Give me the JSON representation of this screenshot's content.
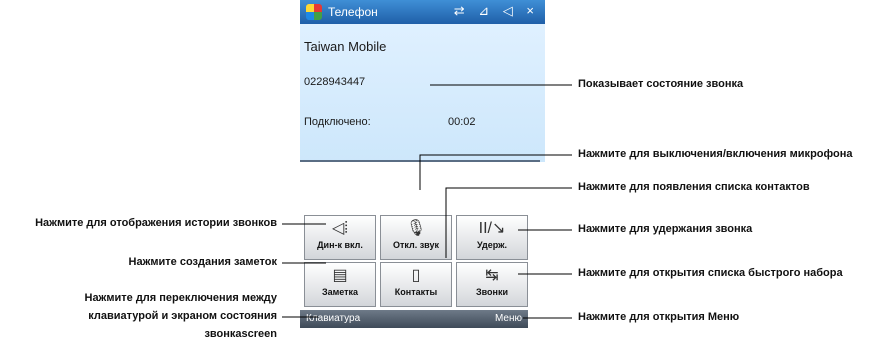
{
  "titlebar": {
    "title": "Телефон",
    "icons": "⇄ ⊿ ◁ ×"
  },
  "call": {
    "carrier": "Taiwan Mobile",
    "number": "0228943447",
    "connected_label": "Подключено:",
    "duration": "00:02"
  },
  "buttons": [
    {
      "label": "Дин-к вкл.",
      "icon": "◁⦙"
    },
    {
      "label": "Откл. звук",
      "icon": "🎙"
    },
    {
      "label": "Удерж.",
      "icon": "II/↘"
    },
    {
      "label": "Заметка",
      "icon": "▤"
    },
    {
      "label": "Контакты",
      "icon": "▯"
    },
    {
      "label": "Звонки",
      "icon": "↹"
    }
  ],
  "softkeys": {
    "left": "Клавиатура",
    "right": "Меню"
  },
  "annotations": {
    "call_status": "Показывает состояние звонка",
    "mute": "Нажмите для выключения/включения микрофона",
    "contacts": "Нажмите для появления списка контактов",
    "hold": "Нажмите для удержания звонка",
    "speed_dial": "Нажмите для открытия списка быстрого набора",
    "menu": "Нажмите для открытия Меню",
    "history": "Нажмите для отображения истории звонков",
    "notes": "Нажмите создания заметок",
    "keyboard_line1": "Нажмите для переключения между",
    "keyboard_line2": "клавиатурой и экраном состояния",
    "keyboard_line3": "звонкаscreen"
  }
}
